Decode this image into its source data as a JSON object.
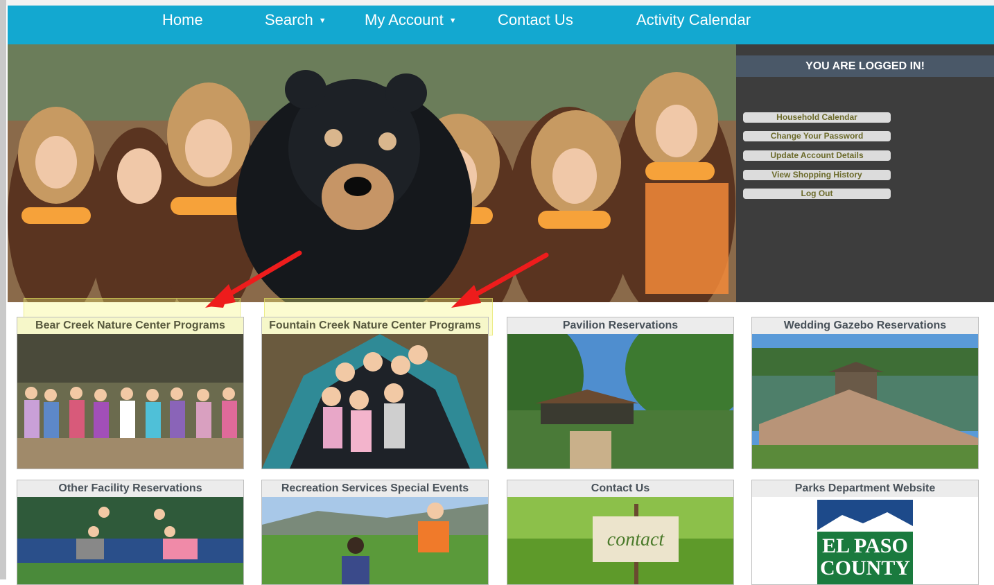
{
  "nav": {
    "home": "Home",
    "search": "Search",
    "my_account": "My Account",
    "contact_us": "Contact Us",
    "activity_calendar": "Activity Calendar"
  },
  "account_panel": {
    "title": "YOU ARE LOGGED IN!",
    "buttons": [
      "Household Calendar",
      "Change Your Password",
      "Update Account Details",
      "View Shopping History",
      "Log Out"
    ]
  },
  "cards": [
    {
      "title": "Bear Creek Nature Center Programs",
      "highlighted": true
    },
    {
      "title": "Fountain Creek Nature Center Programs",
      "highlighted": true
    },
    {
      "title": "Pavilion Reservations"
    },
    {
      "title": "Wedding Gazebo Reservations"
    },
    {
      "title": "Other Facility Reservations"
    },
    {
      "title": "Recreation Services Special Events"
    },
    {
      "title": "Contact Us"
    },
    {
      "title": "Parks Department Website"
    }
  ],
  "images": {
    "contact_sign": "contact",
    "logo_line1": "EL PASO",
    "logo_line2": "COUNTY"
  },
  "colors": {
    "nav_bg": "#13a8d0",
    "panel_bg": "#3d3d3d",
    "panel_title_bg": "#4a5868",
    "annotation_arrow": "#ee1c1c",
    "highlight": "#f6f7c9"
  }
}
